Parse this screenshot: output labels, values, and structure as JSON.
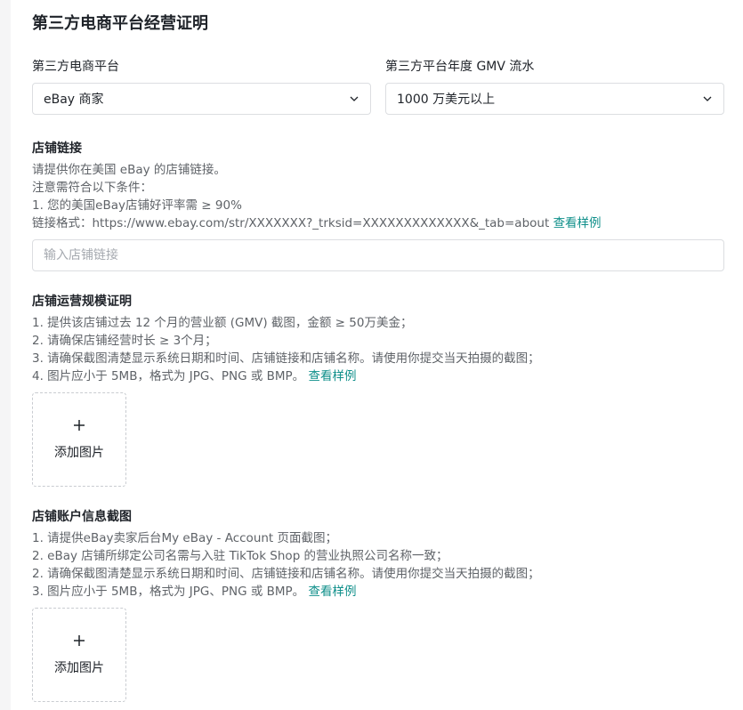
{
  "page": {
    "title": "第三方电商平台经营证明"
  },
  "platform_field": {
    "label": "第三方电商平台",
    "value": "eBay 商家"
  },
  "gmv_field": {
    "label": "第三方平台年度 GMV 流水",
    "value": "1000 万美元以上"
  },
  "store_link": {
    "title": "店铺链接",
    "lines": [
      "请提供你在美国 eBay 的店铺链接。",
      "注意需符合以下条件：",
      "1. 您的美国eBay店铺好评率需 ≥ 90%",
      "链接格式：https://www.ebay.com/str/XXXXXXX?_trksid=XXXXXXXXXXXXX&_tab=about"
    ],
    "sample_link": "查看样例",
    "input_placeholder": "输入店铺链接"
  },
  "scale_proof": {
    "title": "店铺运营规模证明",
    "lines": [
      "1. 提供该店铺过去 12 个月的营业额 (GMV) 截图，金额 ≥ 50万美金；",
      "2. 请确保店铺经营时长 ≥ 3个月；",
      "3. 请确保截图清楚显示系统日期和时间、店铺链接和店铺名称。请使用你提交当天拍摄的截图；",
      "4. 图片应小于 5MB，格式为 JPG、PNG 或 BMP。"
    ],
    "sample_link": "查看样例",
    "upload_label": "添加图片"
  },
  "account_info": {
    "title": "店铺账户信息截图",
    "lines": [
      "1. 请提供eBay卖家后台My eBay - Account 页面截图；",
      "2. eBay 店铺所绑定公司名需与入驻 TikTok Shop 的营业执照公司名称一致；",
      "2. 请确保截图清楚显示系统日期和时间、店铺链接和店铺名称。请使用你提交当天拍摄的截图；",
      "3. 图片应小于 5MB，格式为 JPG、PNG 或 BMP。"
    ],
    "sample_link": "查看样例",
    "upload_label": "添加图片"
  },
  "icons": {
    "select_chevron": "chevron-down-icon",
    "upload": "plus-icon"
  },
  "colors": {
    "link": "#0f8f8a",
    "border": "#dcdee1",
    "text": "#1f2329",
    "muted": "#5f6368"
  }
}
